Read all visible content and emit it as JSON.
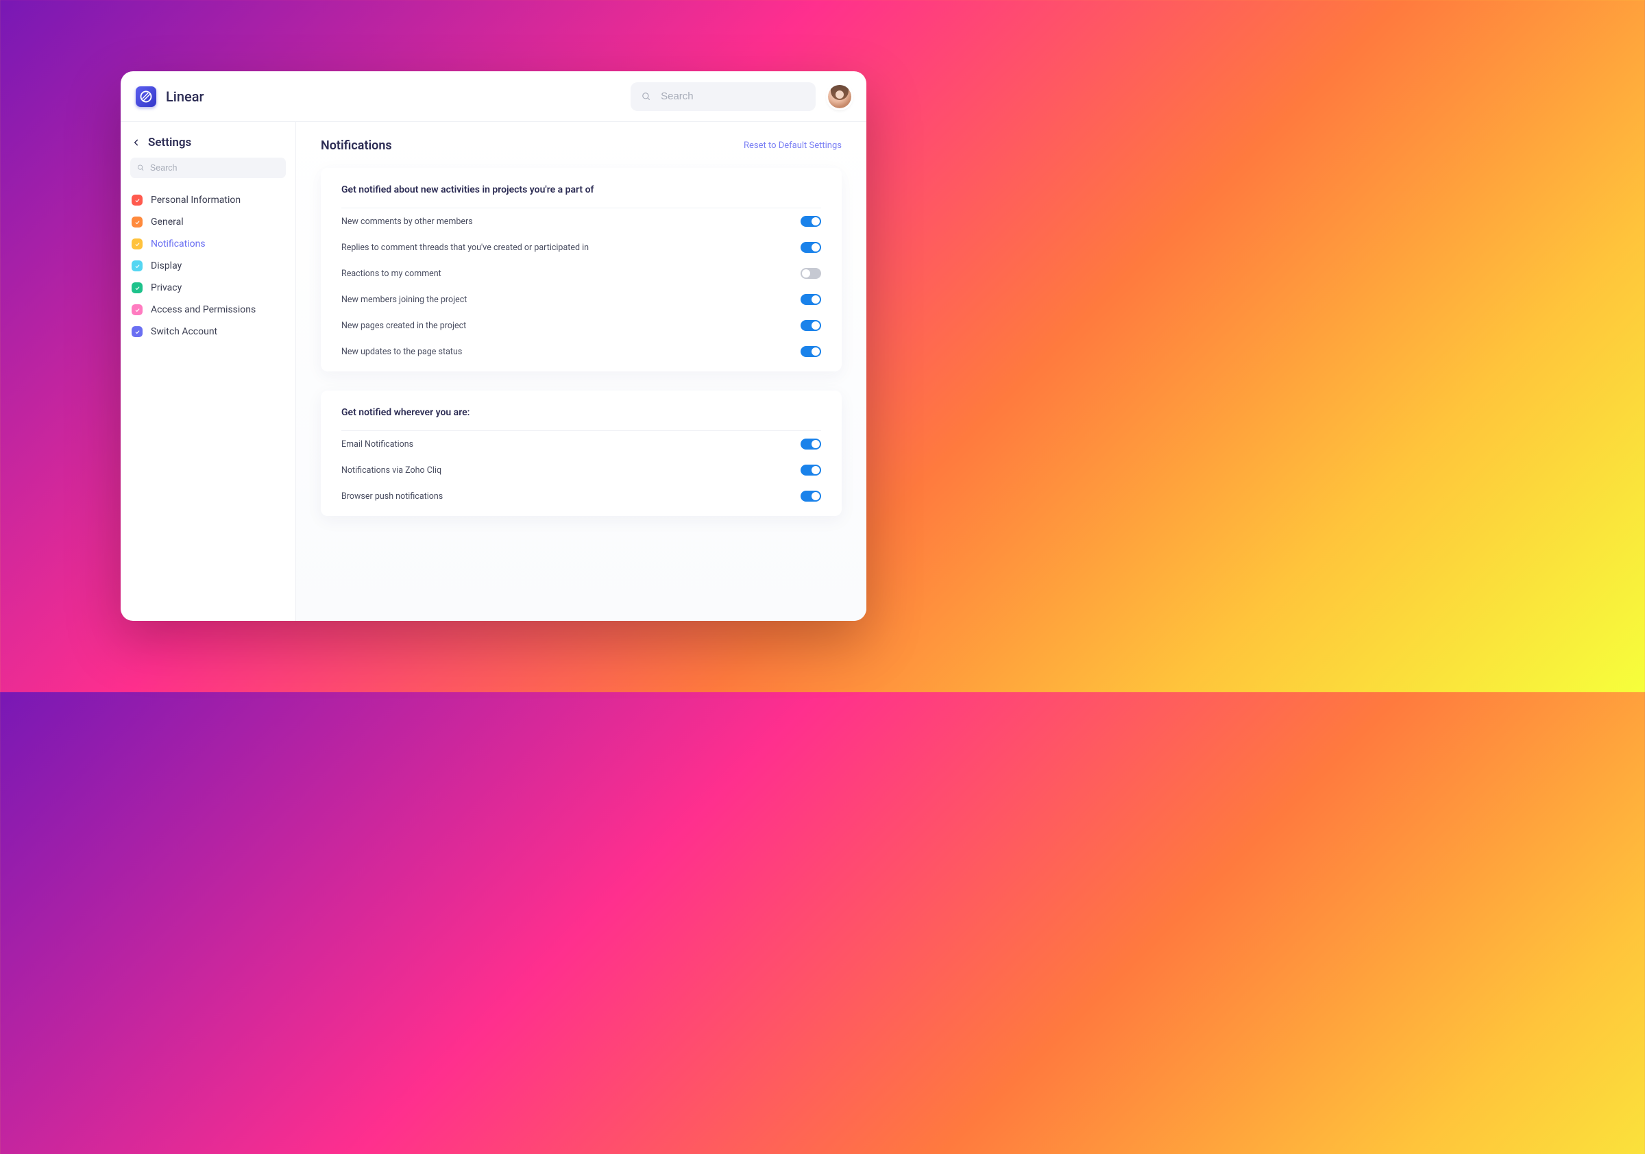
{
  "app": {
    "name": "Linear"
  },
  "topbar": {
    "search_placeholder": "Search"
  },
  "sidebar": {
    "title": "Settings",
    "search_placeholder": "Search",
    "items": [
      {
        "label": "Personal Information",
        "color": "#ff5a4e",
        "active": false
      },
      {
        "label": "General",
        "color": "#ff8a3c",
        "active": false
      },
      {
        "label": "Notifications",
        "color": "#ffc23c",
        "active": true
      },
      {
        "label": "Display",
        "color": "#55d6f2",
        "active": false
      },
      {
        "label": "Privacy",
        "color": "#1ec28b",
        "active": false
      },
      {
        "label": "Access and Permissions",
        "color": "#ff7bc0",
        "active": false
      },
      {
        "label": "Switch Account",
        "color": "#6a6ff2",
        "active": false
      }
    ]
  },
  "main": {
    "title": "Notifications",
    "reset_label": "Reset to Default Settings",
    "cards": [
      {
        "title": "Get notified about new activities in projects you're a part of",
        "rows": [
          {
            "label": "New comments by other members",
            "on": true
          },
          {
            "label": "Replies to comment threads that you've created or participated in",
            "on": true
          },
          {
            "label": "Reactions to my comment",
            "on": false
          },
          {
            "label": "New members joining the project",
            "on": true
          },
          {
            "label": "New pages created in the project",
            "on": true
          },
          {
            "label": "New updates to the page status",
            "on": true
          }
        ]
      },
      {
        "title": "Get notified wherever you are:",
        "rows": [
          {
            "label": "Email Notifications",
            "on": true
          },
          {
            "label": "Notifications via Zoho Cliq",
            "on": true
          },
          {
            "label": "Browser push notifications",
            "on": true
          }
        ]
      }
    ]
  }
}
